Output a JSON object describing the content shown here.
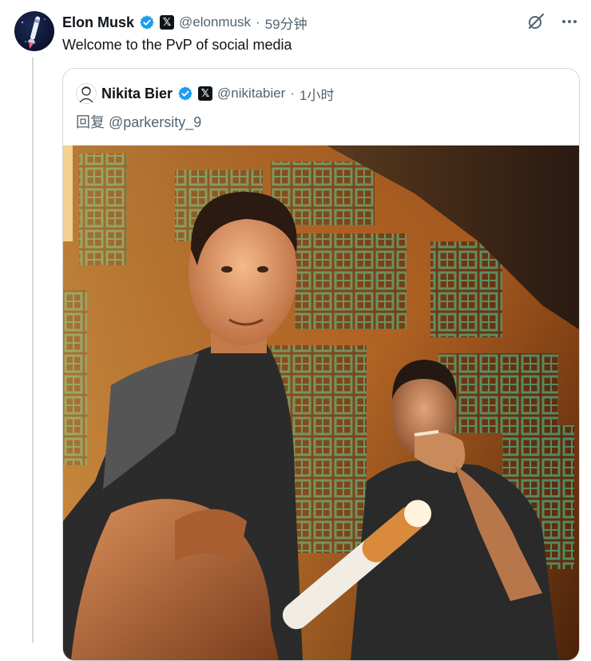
{
  "tweet": {
    "author_name": "Elon Musk",
    "handle": "@elonmusk",
    "separator": "·",
    "time": "59分钟",
    "text": "Welcome to the PvP of social media"
  },
  "quote": {
    "author_name": "Nikita Bier",
    "handle": "@nikitabier",
    "separator": "·",
    "time": "1小时",
    "reply_to": "回复 @parkersity_9"
  },
  "icons": {
    "verified": "verified-badge-icon",
    "affiliate": "x-logo-icon",
    "grok": "grok-icon",
    "more": "more-icon"
  },
  "colors": {
    "verified_blue": "#1d9bf0",
    "muted": "#536471",
    "border": "#cfd9de"
  }
}
